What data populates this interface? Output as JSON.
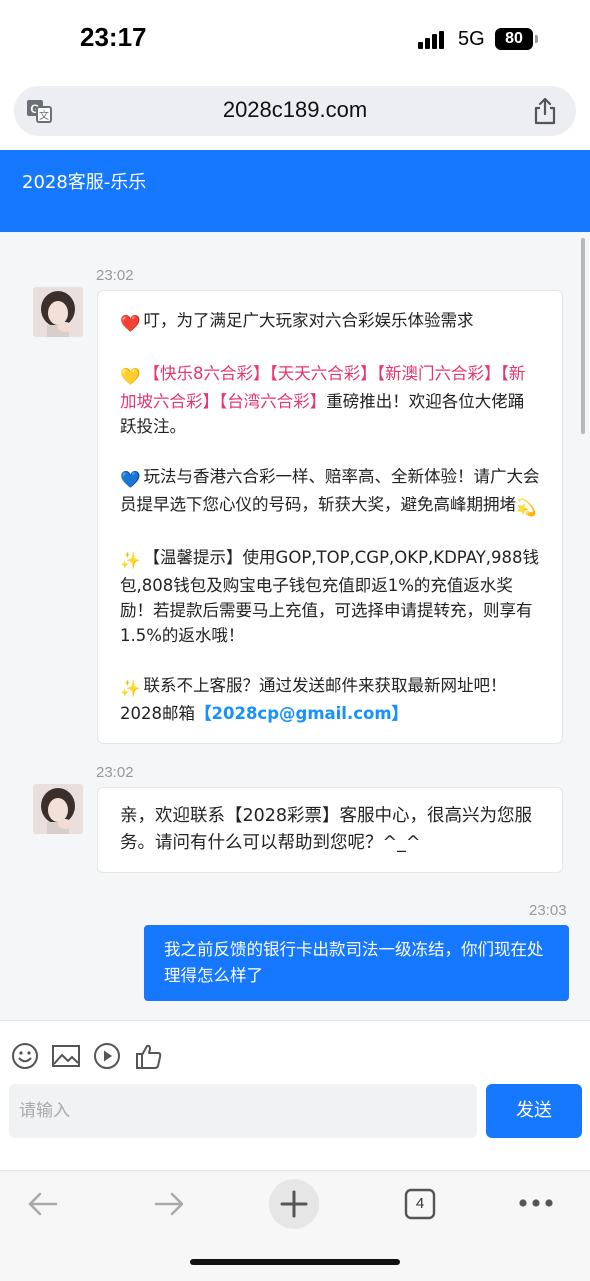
{
  "status_bar": {
    "time": "23:17",
    "network": "5G",
    "battery": "80"
  },
  "browser": {
    "url": "2028c189.com",
    "icons": {
      "translate": "translate-icon",
      "share": "share-icon"
    }
  },
  "chat": {
    "title": "2028客服-乐乐",
    "messages": [
      {
        "timestamp": "23:02",
        "paragraphs": {
          "p1": {
            "emoji": "❤️",
            "text": "叮，为了满足广大玩家对六合彩娱乐体验需求"
          },
          "p2": {
            "emoji": "💛",
            "highlight": "【快乐8六合彩】【天天六合彩】【新澳门六合彩】【新加坡六合彩】【台湾六合彩】",
            "text": "重磅推出！欢迎各位大佬踊跃投注。"
          },
          "p3": {
            "emoji": "💙",
            "text": "玩法与香港六合彩一样、赔率高、全新体验！请广大会员提早选下您心仪的号码，斩获大奖，避免高峰期拥堵",
            "trail_emoji": "💫"
          },
          "p4": {
            "emoji": "✨",
            "text": "【温馨提示】使用GOP,TOP,CGP,OKP,KDPAY,988钱包,808钱包及购宝电子钱包充值即返1%的充值返水奖励！若提款后需要马上充值，可选择申请提转充，则享有1.5%的返水哦！"
          },
          "p5": {
            "emoji": "✨",
            "text": "联系不上客服？通过发送邮件来获取最新网址吧！2028邮箱",
            "email": "【2028cp@gmail.com】"
          }
        }
      },
      {
        "timestamp": "23:02",
        "text": "亲，欢迎联系【2028彩票】客服中心，很高兴为您服务。请问有什么可以帮助到您呢？^_^"
      },
      {
        "timestamp": "23:03",
        "text": "我之前反馈的银行卡出款司法一级冻结，你们现在处理得怎么样了"
      }
    ]
  },
  "composer": {
    "tools": [
      "emoji-icon",
      "image-icon",
      "video-icon",
      "thumbs-up-icon"
    ],
    "placeholder": "请输入",
    "send_label": "发送"
  },
  "browser_nav": {
    "tab_count": "4"
  },
  "colors": {
    "accent": "#1677ff",
    "pink": "#e8356d",
    "link": "#1890ff"
  }
}
